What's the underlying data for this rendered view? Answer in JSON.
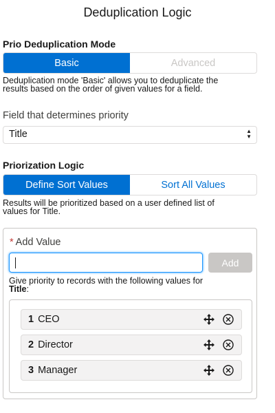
{
  "header": {
    "title": "Deduplication Logic"
  },
  "dedup_mode": {
    "label": "Prio Deduplication Mode",
    "options": [
      {
        "label": "Basic",
        "state": "selected"
      },
      {
        "label": "Advanced",
        "state": "disabled"
      }
    ],
    "help_line1": "Deduplication mode 'Basic' allows you to deduplicate the",
    "help_line2": "results based on the order of given values for a field."
  },
  "priority_field": {
    "label": "Field that determines priority",
    "value": "Title"
  },
  "priorization": {
    "label": "Priorization Logic",
    "options": [
      {
        "label": "Define Sort Values",
        "state": "selected"
      },
      {
        "label": "Sort All Values",
        "state": "unselected"
      }
    ],
    "help_line1": "Results will be prioritized based on a user defined list of",
    "help_line2": "values for Title."
  },
  "add_value": {
    "required_mark": "*",
    "label": "Add Value",
    "input_value": "",
    "button_label": "Add",
    "priority_text_line1": "Give priority to records with the following values for",
    "priority_field_name": "Title",
    "priority_colon": ":"
  },
  "values_list": [
    {
      "number": "1",
      "label": "CEO"
    },
    {
      "number": "2",
      "label": "Director"
    },
    {
      "number": "3",
      "label": "Manager"
    }
  ],
  "icons": {
    "move": "move-icon",
    "remove": "remove-icon"
  },
  "colors": {
    "brand": "#0070d2",
    "disabled": "#c9c7c5",
    "required": "#c23934",
    "focus": "#1b96ff"
  }
}
